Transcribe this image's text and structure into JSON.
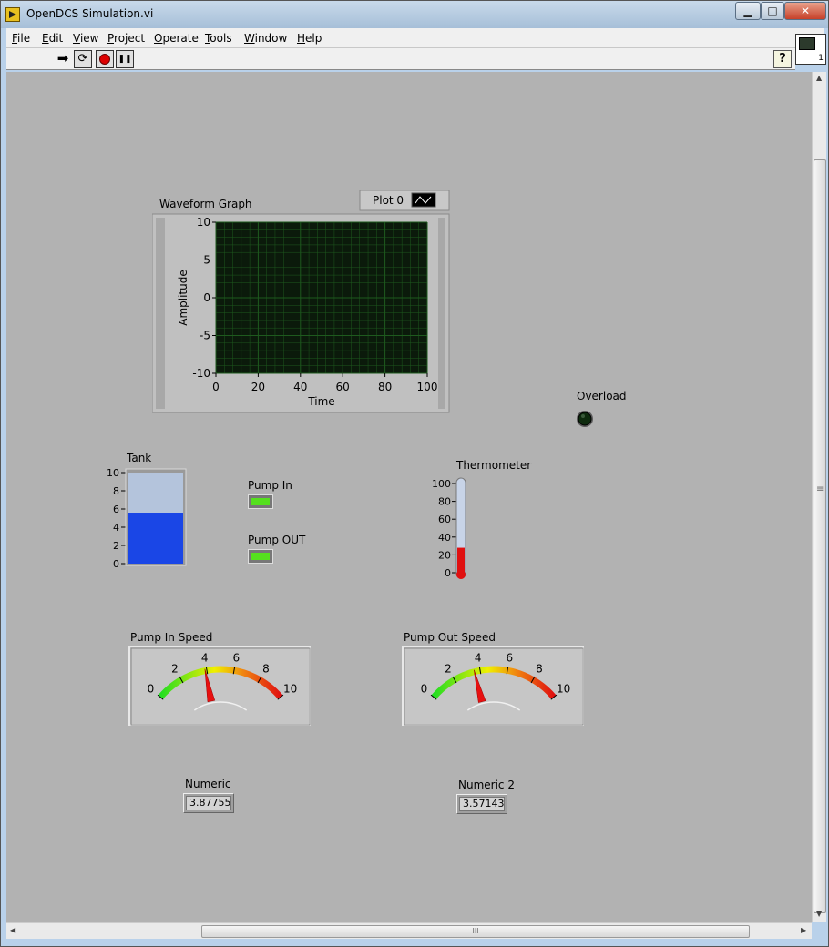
{
  "window": {
    "title": "OpenDCS Simulation.vi",
    "min_glyph": "▁",
    "max_glyph": "□",
    "close_glyph": "✕"
  },
  "menu": {
    "items": [
      {
        "first": "F",
        "rest": "ile"
      },
      {
        "first": "E",
        "rest": "dit"
      },
      {
        "first": "V",
        "rest": "iew"
      },
      {
        "first": "P",
        "rest": "roject"
      },
      {
        "first": "O",
        "rest": "perate"
      },
      {
        "first": "T",
        "rest": "ools"
      },
      {
        "first": "W",
        "rest": "indow"
      },
      {
        "first": "H",
        "rest": "elp"
      }
    ]
  },
  "toolbar": {
    "run_glyph": "➡",
    "run_continuous_glyph": "⟳",
    "pause_glyph": "❚❚",
    "help_glyph": "?"
  },
  "vi_icon": {
    "number": "1"
  },
  "waveform": {
    "label": "Waveform Graph",
    "legend_label": "Plot 0",
    "x_axis_label": "Time",
    "y_axis_label": "Amplitude",
    "x_ticks": [
      "0",
      "20",
      "40",
      "60",
      "80",
      "100"
    ],
    "y_ticks": [
      "10",
      "5",
      "0",
      "-5",
      "-10"
    ],
    "xlim": [
      0,
      100
    ],
    "ylim": [
      -10,
      10
    ],
    "plot_background": "#0b1a0b",
    "grid_color": "#1e5a1e"
  },
  "overload": {
    "label": "Overload",
    "state": "off",
    "color": "#0d2a0d"
  },
  "tank": {
    "label": "Tank",
    "ticks": [
      "10",
      "8",
      "6",
      "4",
      "2",
      "0"
    ],
    "range": [
      0,
      10
    ],
    "level": 5.6,
    "fill_color": "#1a46e6"
  },
  "pump_in": {
    "label": "Pump In",
    "state": "on",
    "color": "#55e01e"
  },
  "pump_out": {
    "label": "Pump OUT",
    "state": "on",
    "color": "#55e01e"
  },
  "thermometer": {
    "label": "Thermometer",
    "ticks": [
      "100",
      "80",
      "60",
      "40",
      "20",
      "0"
    ],
    "range": [
      0,
      100
    ],
    "level": 28,
    "fill_color": "#e01010"
  },
  "pump_in_speed": {
    "label": "Pump In Speed",
    "ticks": [
      "0",
      "2",
      "4",
      "6",
      "8",
      "10"
    ],
    "range": [
      0,
      10
    ],
    "value": 3.87755
  },
  "pump_out_speed": {
    "label": "Pump Out Speed",
    "ticks": [
      "0",
      "2",
      "4",
      "6",
      "8",
      "10"
    ],
    "range": [
      0,
      10
    ],
    "value": 3.57143
  },
  "numeric": {
    "label": "Numeric",
    "value": "3.87755"
  },
  "numeric2": {
    "label": "Numeric 2",
    "value": "3.57143"
  },
  "scroll": {
    "grip_glyph": "III",
    "up": "▲",
    "down": "▼",
    "left": "◀",
    "right": "▶",
    "vgrip": "≡"
  }
}
